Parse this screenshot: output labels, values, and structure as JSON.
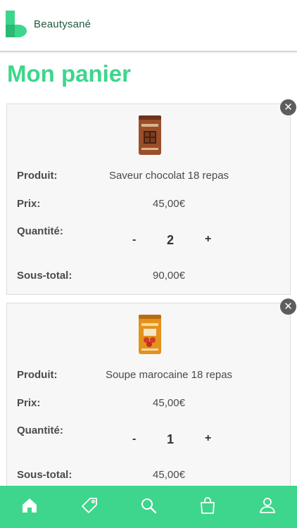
{
  "brand": {
    "name": "Beautysané",
    "accent": "#3dd68c",
    "dark": "#1f5a3d"
  },
  "page": {
    "title": "Mon panier"
  },
  "labels": {
    "product": "Produit:",
    "price": "Prix:",
    "quantity": "Quantité:",
    "subtotal": "Sous-total:",
    "minus": "-",
    "plus": "+",
    "remove": "✕"
  },
  "cart": {
    "items": [
      {
        "name": "Saveur chocolat 18 repas",
        "price": "45,00€",
        "quantity": "2",
        "subtotal": "90,00€",
        "image_color": "#9a4e2a",
        "image_icon": "chocolate-product-icon"
      },
      {
        "name": "Soupe marocaine 18 repas",
        "price": "45,00€",
        "quantity": "1",
        "subtotal": "45,00€",
        "image_color": "#e3921c",
        "image_icon": "soup-product-icon"
      }
    ]
  },
  "tabbar": {
    "items": [
      {
        "icon": "home-icon"
      },
      {
        "icon": "tag-icon"
      },
      {
        "icon": "search-icon"
      },
      {
        "icon": "shopping-bag-icon"
      },
      {
        "icon": "user-icon"
      }
    ]
  }
}
